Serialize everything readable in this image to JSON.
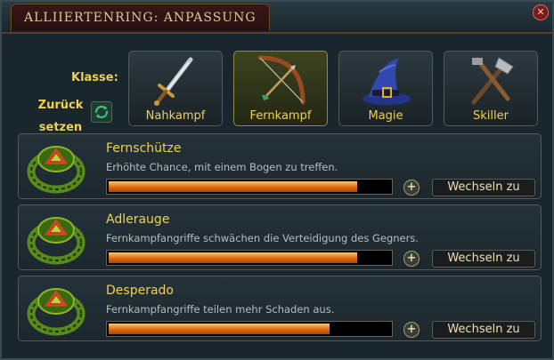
{
  "window": {
    "title": "ALLIIERTENRING: ANPASSUNG",
    "close_glyph": "✕"
  },
  "klasse_label": "Klasse:",
  "reset": {
    "label_line1": "Zurück",
    "label_line2": "setzen",
    "icon": "reset-icon"
  },
  "classes": [
    {
      "label": "Nahkampf",
      "icon": "sword-icon",
      "selected": false
    },
    {
      "label": "Fernkampf",
      "icon": "bow-icon",
      "selected": true
    },
    {
      "label": "Magie",
      "icon": "wizard-hat-icon",
      "selected": false
    },
    {
      "label": "Skiller",
      "icon": "tools-icon",
      "selected": false
    }
  ],
  "perks": [
    {
      "name": "Fernschütze",
      "description": "Erhöhte Chance, mit einem Bogen zu treffen.",
      "progress": 0.89,
      "button": "Wechseln zu",
      "plus": "+"
    },
    {
      "name": "Adlerauge",
      "description": "Fernkampfangriffe schwächen die Verteidigung des Gegners.",
      "progress": 0.89,
      "button": "Wechseln zu",
      "plus": "+"
    },
    {
      "name": "Desperado",
      "description": "Fernkampfangriffe teilen mehr Schaden aus.",
      "progress": 0.79,
      "button": "Wechseln zu",
      "plus": "+"
    }
  ],
  "colors": {
    "accent_text": "#f0d050",
    "bar_fill": "#e06a10",
    "title_text": "#e0c590"
  }
}
